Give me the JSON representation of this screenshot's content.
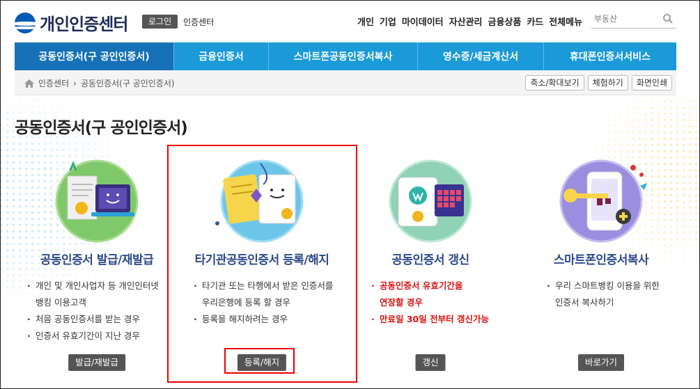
{
  "header": {
    "logo_text": "개인인증센터",
    "login_label": "로그인",
    "center_label": "인증센터",
    "top_nav": [
      "개인",
      "기업",
      "마이데이터",
      "자산관리",
      "금융상품",
      "카드",
      "전체메뉴"
    ],
    "search_placeholder": "부동산"
  },
  "main_nav": {
    "tabs": [
      {
        "label": "공동인증서(구 공인인증서)",
        "active": true
      },
      {
        "label": "금융인증서",
        "active": false
      },
      {
        "label": "스마트폰공동인증서복사",
        "active": false
      },
      {
        "label": "영수증/세금계산서",
        "active": false
      },
      {
        "label": "휴대폰인증서서비스",
        "active": false
      }
    ]
  },
  "breadcrumb": {
    "items": [
      "인증센터",
      "공동인증서(구 공인인증서)"
    ],
    "separator": "›"
  },
  "utilities": {
    "zoom_label": "축소/확대보기",
    "demo_label": "체험하기",
    "print_label": "화면인쇄"
  },
  "page": {
    "title": "공동인증서(구 공인인증서)"
  },
  "cards": [
    {
      "title": "공동인증서 발급/재발급",
      "lines": [
        {
          "text": "개인 및 개인사업자 등 개인인터넷",
          "bullet": true
        },
        {
          "text": "뱅킹 이용고객",
          "bullet": false
        },
        {
          "text": "처음 공동인증서를 받는 경우",
          "bullet": true
        },
        {
          "text": "인증서 유효기간이 지난 경우",
          "bullet": true
        }
      ],
      "button": "발급/재발급"
    },
    {
      "title": "타기관공동인증서 등록/해지",
      "lines": [
        {
          "text": "타기관 또는 타행에서 받은 인증서를",
          "bullet": true
        },
        {
          "text": "우리은행에 등록 할 경우",
          "bullet": false
        },
        {
          "text": "등록을 해지하려는 경우",
          "bullet": true
        }
      ],
      "button": "등록/해지"
    },
    {
      "title": "공동인증서 갱신",
      "lines": [
        {
          "text": "공동인증서 유효기간을",
          "bullet": true
        },
        {
          "text": "연장할 경우",
          "bullet": false
        },
        {
          "text": "만료일 30일 전부터 갱신가능",
          "bullet": true
        }
      ],
      "button": "갱신"
    },
    {
      "title": "스마트폰인증서복사",
      "lines": [
        {
          "text": "우리 스마트뱅킹 이용을 위한",
          "bullet": true
        },
        {
          "text": "인증서 복사하기",
          "bullet": false
        }
      ],
      "button": "바로가기"
    }
  ],
  "colors": {
    "nav_blue": "#1a9ad9",
    "nav_active": "#1671b8",
    "title_navy": "#2c4a8a",
    "alert_red": "#dd1111",
    "highlight_red": "#ee0000"
  },
  "icons": {
    "logo": "woori-logo-icon",
    "search": "search-icon",
    "home": "home-icon"
  }
}
